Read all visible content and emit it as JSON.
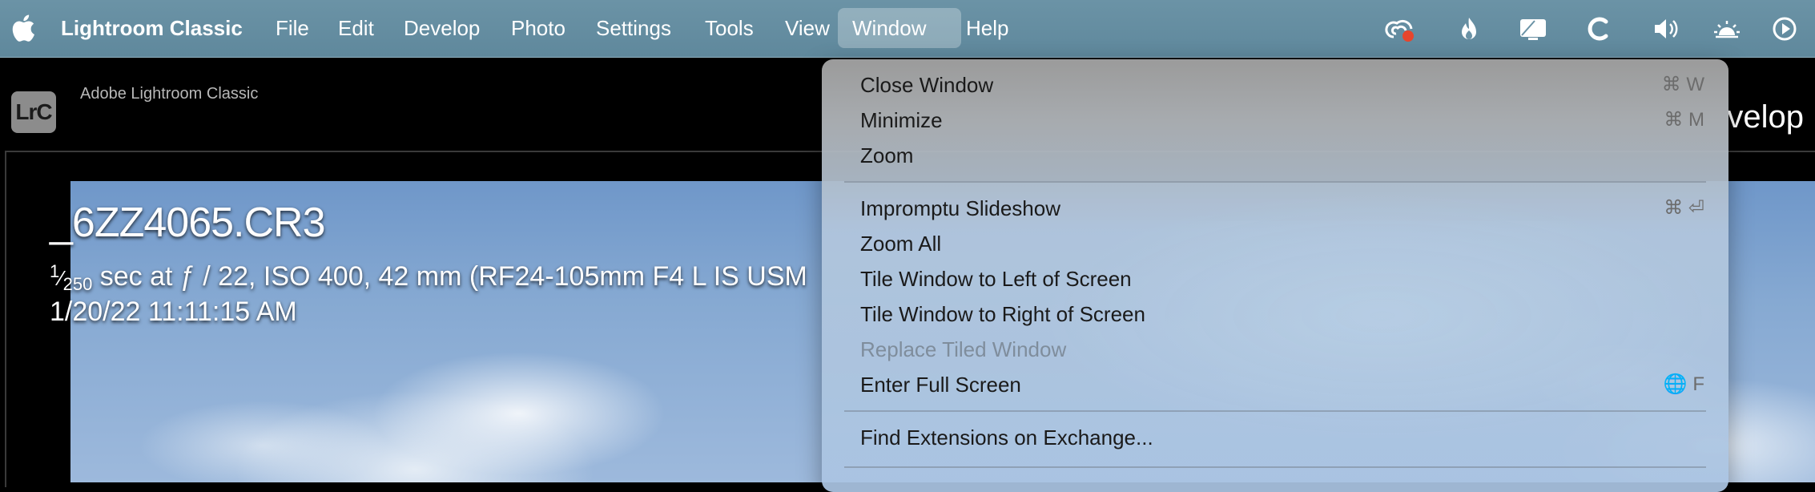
{
  "menubar": {
    "app_name": "Lightroom Classic",
    "items": [
      "File",
      "Edit",
      "Develop",
      "Photo",
      "Settings",
      "Tools",
      "View",
      "Window",
      "Help"
    ],
    "active_item": "Window",
    "status_icons": [
      "creative-cloud-icon",
      "flame-app-icon",
      "display-icon",
      "loading-c-icon",
      "volume-icon",
      "brightness-icon",
      "play-circle-icon"
    ]
  },
  "lightroom": {
    "badge": "LrC",
    "product_name": "Adobe Lightroom Classic",
    "module_partial": "velop"
  },
  "photo_info": {
    "filename": "_6ZZ4065.CR3",
    "shutter_num": "1",
    "shutter_den": "250",
    "exposure_rest": " sec at ƒ / 22, ISO 400, 42 mm (RF24-105mm F4 L IS USM",
    "capture_date": "1/20/22 11:11:15 AM"
  },
  "window_menu": {
    "items": [
      {
        "label": "Close Window",
        "shortcut": "⌘ W",
        "enabled": true
      },
      {
        "label": "Minimize",
        "shortcut": "⌘ M",
        "enabled": true
      },
      {
        "label": "Zoom",
        "shortcut": "",
        "enabled": true
      },
      {
        "label": "Impromptu Slideshow",
        "shortcut": "⌘ ⏎",
        "enabled": true
      },
      {
        "label": "Zoom All",
        "shortcut": "",
        "enabled": true
      },
      {
        "label": "Tile Window to Left of Screen",
        "shortcut": "",
        "enabled": true
      },
      {
        "label": "Tile Window to Right of Screen",
        "shortcut": "",
        "enabled": true
      },
      {
        "label": "Replace Tiled Window",
        "shortcut": "",
        "enabled": false
      },
      {
        "label": "Enter Full Screen",
        "shortcut": "🌐 F",
        "enabled": true
      },
      {
        "label": "Find Extensions on Exchange...",
        "shortcut": "",
        "enabled": true
      }
    ]
  },
  "colors": {
    "menubar": "#6389a0",
    "notification_dot": "#e8452c"
  }
}
